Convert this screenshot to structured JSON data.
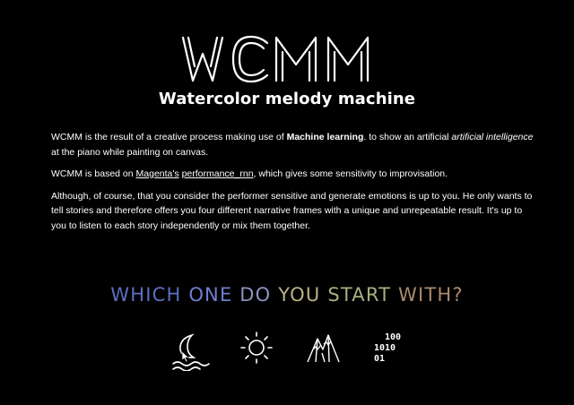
{
  "header": {
    "logo_text": "WCMM",
    "subtitle": "Watercolor melody machine"
  },
  "intro": {
    "p1_a": "WCMM is the result of a creative process making use of ",
    "p1_bold": "Machine learning",
    "p1_b": ". to show an artificial ",
    "p1_italic": "artificial intelligence",
    "p1_c": " at the piano while painting on canvas.",
    "p2_a": "WCMM is based on ",
    "p2_link1": "Magenta's",
    "p2_space": " ",
    "p2_link2": "performance_rnn",
    "p2_b": ", which gives some sensitivity to improvisation.",
    "p3": "Although, of course, that you consider the performer sensitive and generate emotions is up to you. He only wants to tell stories and therefore offers you four different narrative frames with a unique and unrepeatable result. It's up to you to listen to each story independently or mix them together."
  },
  "prompt": {
    "words": [
      {
        "text": "WHICH ",
        "color": "#5a6fc0"
      },
      {
        "text": "ONE ",
        "color": "#6f7fcf"
      },
      {
        "text": "DO ",
        "color": "#8f92c0"
      },
      {
        "text": "YOU ",
        "color": "#b6b486"
      },
      {
        "text": "START ",
        "color": "#a9b07e"
      },
      {
        "text": "WITH?",
        "color": "#a98a6e"
      }
    ]
  },
  "options": [
    {
      "icon": "moon-waves-icon",
      "label": "night"
    },
    {
      "icon": "sun-icon",
      "label": "day"
    },
    {
      "icon": "mountains-icon",
      "label": "mountains"
    },
    {
      "icon": "binary-icon",
      "label": "machine",
      "digits": [
        "100",
        "1010",
        "01"
      ]
    }
  ]
}
